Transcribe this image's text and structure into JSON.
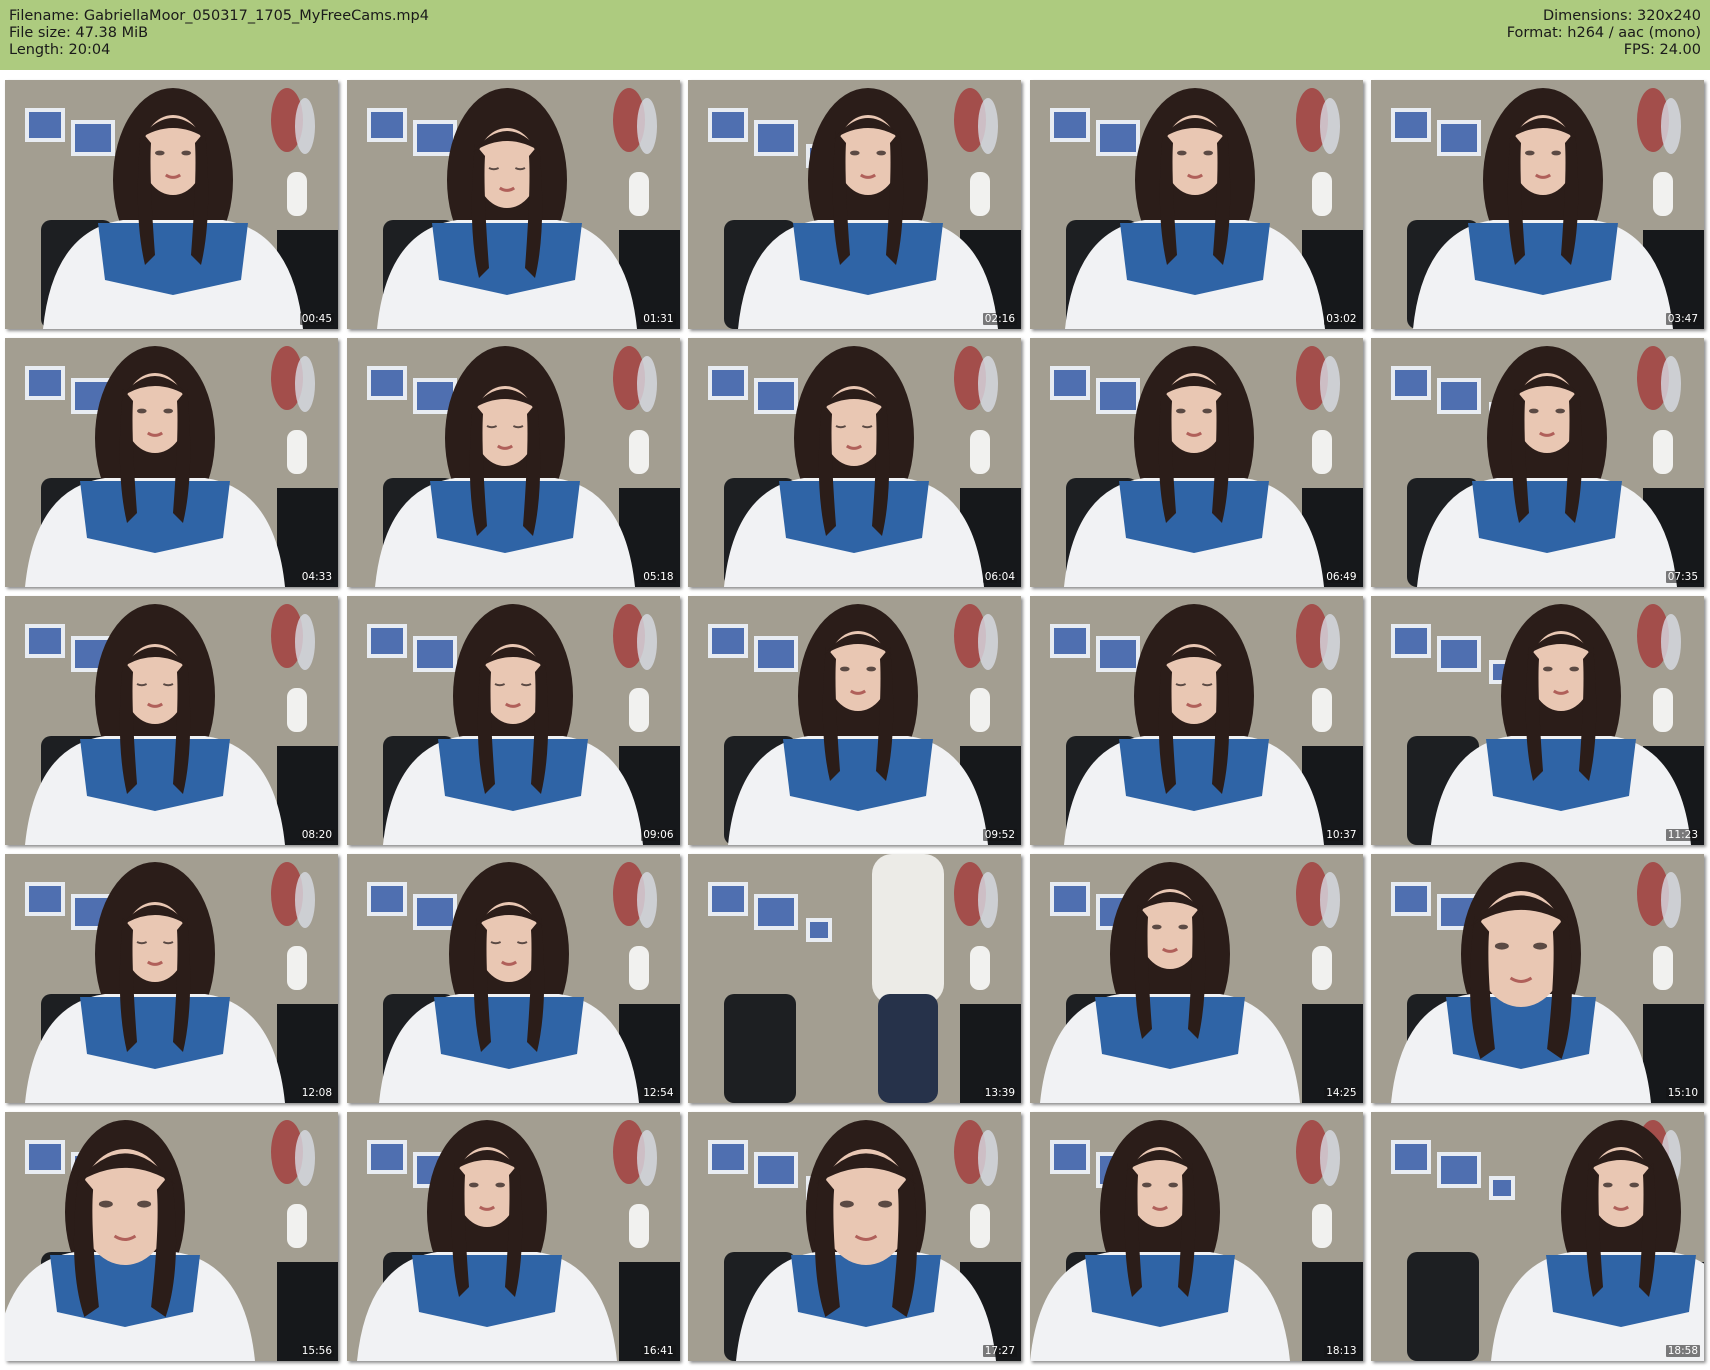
{
  "header": {
    "filename_line": "Filename: GabriellaMoor_050317_1705_MyFreeCams.mp4",
    "filesize_line": "File size: 47.38 MiB",
    "length_line": "Length: 20:04",
    "dimensions_line": "Dimensions: 320x240",
    "format_line": "Format: h264 / aac (mono)",
    "fps_line": "FPS: 24.00"
  },
  "colors": {
    "header_bg": "#adcb7f",
    "page_bg": "#ffffff"
  },
  "thumbnails": [
    {
      "timestamp": "00:45"
    },
    {
      "timestamp": "01:31"
    },
    {
      "timestamp": "02:16"
    },
    {
      "timestamp": "03:02"
    },
    {
      "timestamp": "03:47"
    },
    {
      "timestamp": "04:33"
    },
    {
      "timestamp": "05:18"
    },
    {
      "timestamp": "06:04"
    },
    {
      "timestamp": "06:49"
    },
    {
      "timestamp": "07:35"
    },
    {
      "timestamp": "08:20"
    },
    {
      "timestamp": "09:06"
    },
    {
      "timestamp": "09:52"
    },
    {
      "timestamp": "10:37"
    },
    {
      "timestamp": "11:23"
    },
    {
      "timestamp": "12:08"
    },
    {
      "timestamp": "12:54"
    },
    {
      "timestamp": "13:39"
    },
    {
      "timestamp": "14:25"
    },
    {
      "timestamp": "15:10"
    },
    {
      "timestamp": "15:56"
    },
    {
      "timestamp": "16:41"
    },
    {
      "timestamp": "17:27"
    },
    {
      "timestamp": "18:13"
    },
    {
      "timestamp": "18:58"
    }
  ]
}
